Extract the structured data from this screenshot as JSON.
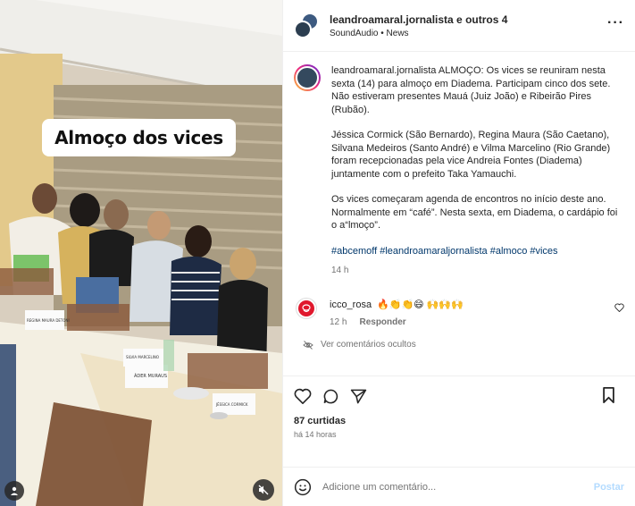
{
  "media": {
    "overlay_text": "Almoço dos vices",
    "place_cards": [
      "REGINA MAURA DETONI",
      "SILVIA MARCELINO",
      "ÁDER MURAUS",
      "JÉSSICA CORMICK"
    ]
  },
  "header": {
    "title": "leandroamaral.jornalista e outros 4",
    "subtitle": "SoundAudio • News"
  },
  "caption": {
    "username": "leandroamaral.jornalista",
    "p1": "ALMOÇO: Os vices se reuniram nesta sexta (14) para almoço em Diadema. Participam cinco dos sete. Não estiveram presentes Mauá (Juiz João) e Ribeirão Pires (Rubão).",
    "p2": "Jéssica Cormick (São Bernardo), Regina Maura (São Caetano), Silvana Medeiros (Santo André) e Vilma Marcelino (Rio Grande) foram recepcionadas pela vice Andreia Fontes (Diadema) juntamente com o prefeito Taka Yamauchi.",
    "p3": "Os vices começaram agenda de encontros no início deste ano. Normalmente em “café”. Nesta sexta, em Diadema, o cardápio foi o a“lmoço”.",
    "hashtags": "#abcemoff #leandroamaraljornalista #almoco #vices",
    "time": "14 h"
  },
  "comment": {
    "username": "icco_rosa",
    "emojis": "🔥👏👏😄 🙌🙌🙌",
    "time": "12 h",
    "reply": "Responder"
  },
  "hidden_comments": "Ver comentários ocultos",
  "stats": {
    "likes": "87 curtidas",
    "time": "há 14 horas"
  },
  "add_comment": {
    "placeholder": "Adicione um comentário...",
    "post": "Postar"
  },
  "colors": {
    "link": "#00376b",
    "post_disabled": "#b3dbff",
    "icco_red": "#e0182d"
  }
}
